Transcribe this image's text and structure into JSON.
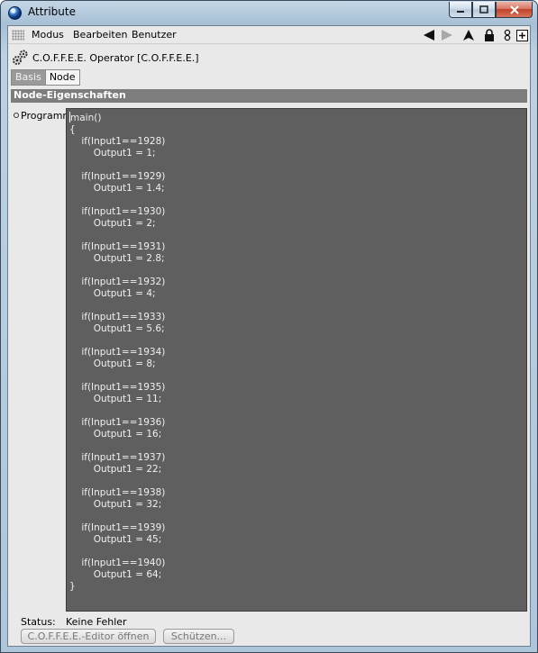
{
  "window": {
    "title": "Attribute"
  },
  "menubar": {
    "items": [
      "Modus",
      "Bearbeiten",
      "Benutzer"
    ]
  },
  "toolbar_icons": [
    "back-arrow-icon",
    "forward-arrow-icon",
    "up-arrow-icon",
    "lock-icon",
    "link-icon",
    "new-window-icon"
  ],
  "header": {
    "title": "C.O.F.F.E.E. Operator [C.O.F.F.E.E.]"
  },
  "tabs": [
    {
      "label": "Basis",
      "active": false
    },
    {
      "label": "Node",
      "active": true
    }
  ],
  "section": {
    "title": "Node-Eigenschaften"
  },
  "property": {
    "label": "Programm",
    "code": "main()\n{\n    if(Input1==1928)\n        Output1 = 1;\n\n    if(Input1==1929)\n        Output1 = 1.4;\n\n    if(Input1==1930)\n        Output1 = 2;\n\n    if(Input1==1931)\n        Output1 = 2.8;\n\n    if(Input1==1932)\n        Output1 = 4;\n\n    if(Input1==1933)\n        Output1 = 5.6;\n\n    if(Input1==1934)\n        Output1 = 8;\n\n    if(Input1==1935)\n        Output1 = 11;\n\n    if(Input1==1936)\n        Output1 = 16;\n\n    if(Input1==1937)\n        Output1 = 22;\n\n    if(Input1==1938)\n        Output1 = 32;\n\n    if(Input1==1939)\n        Output1 = 45;\n\n    if(Input1==1940)\n        Output1 = 64;\n}"
  },
  "status": {
    "label": "Status:",
    "value": "Keine Fehler"
  },
  "buttons": {
    "editor": "C.O.F.F.E.E.-Editor öffnen",
    "protect": "Schützen..."
  }
}
